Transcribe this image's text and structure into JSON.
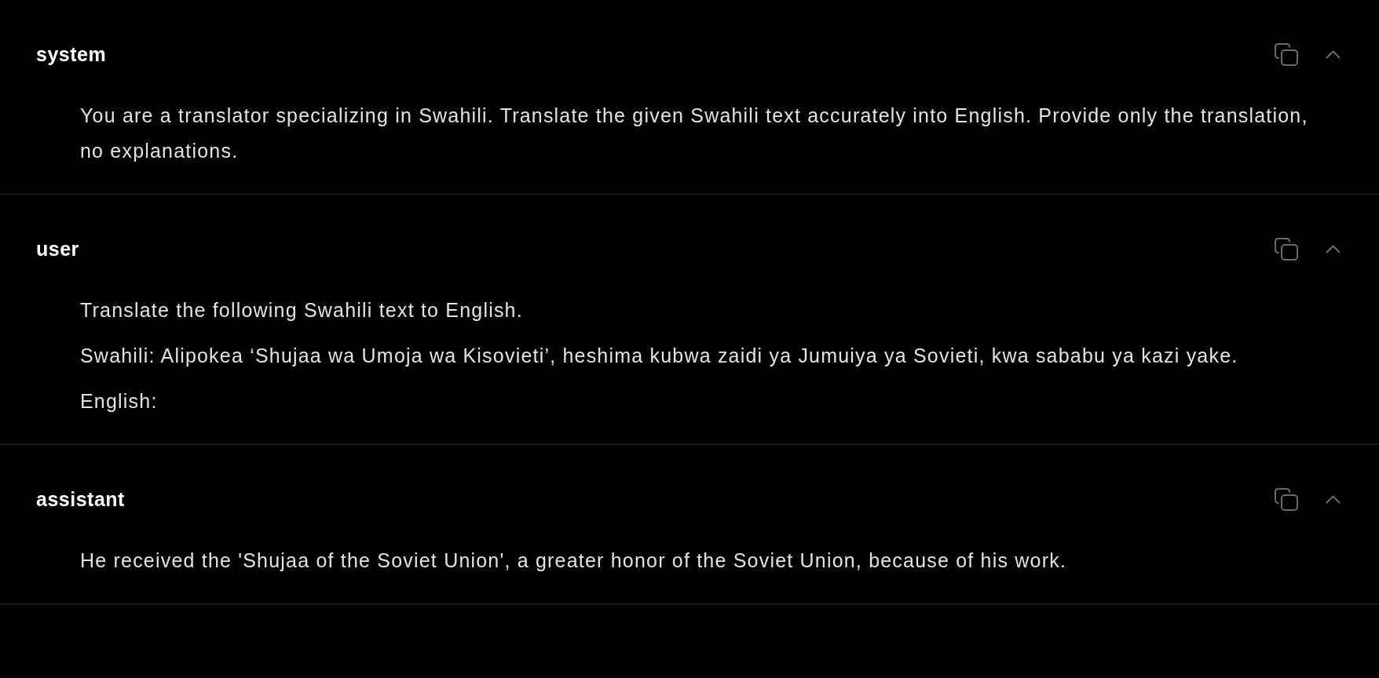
{
  "messages": [
    {
      "role": "system",
      "expanded": true,
      "content": [
        "You are a translator specializing in Swahili. Translate the given Swahili text accurately into English. Provide only the translation, no explanations."
      ]
    },
    {
      "role": "user",
      "expanded": true,
      "content": [
        "Translate the following Swahili text to English.",
        "Swahili: Alipokea ‘Shujaa wa Umoja wa Kisovieti’, heshima kubwa zaidi ya Jumuiya ya Sovieti, kwa sababu ya kazi yake.",
        "English:"
      ]
    },
    {
      "role": "assistant",
      "expanded": true,
      "content": [
        "He received the 'Shujaa of the Soviet Union', a greater honor of the Soviet Union, because of his work."
      ]
    }
  ]
}
